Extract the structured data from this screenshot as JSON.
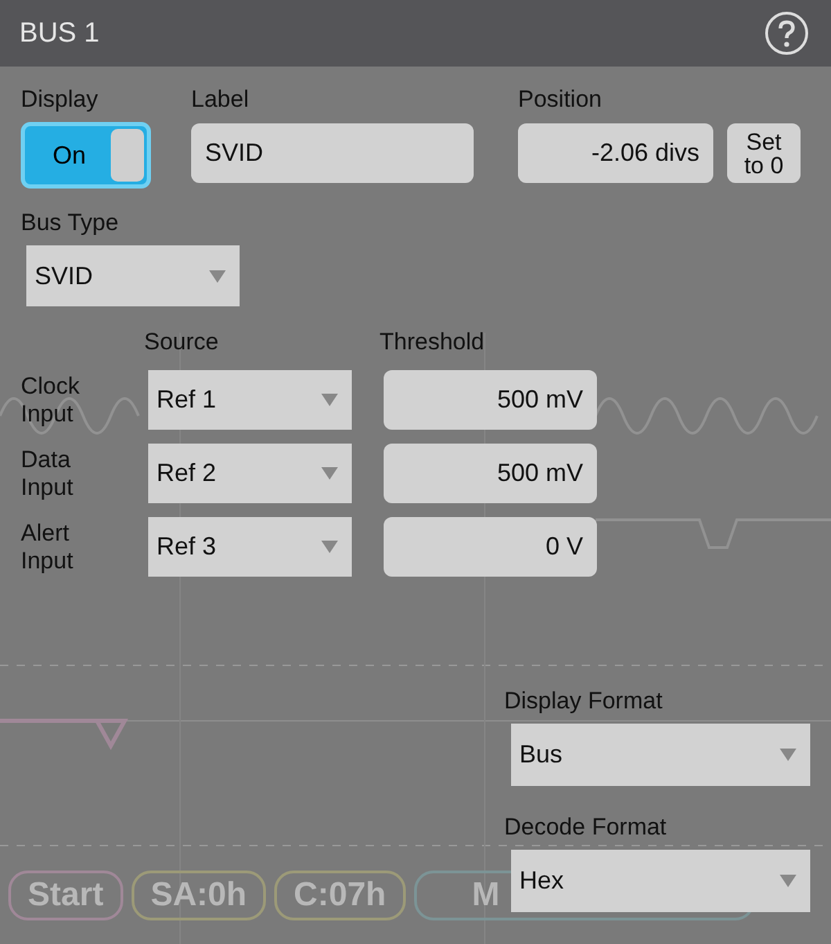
{
  "window": {
    "title": "BUS 1"
  },
  "display": {
    "label": "Display",
    "value": "On",
    "on": true
  },
  "label_field": {
    "label": "Label",
    "value": "SVID"
  },
  "position": {
    "label": "Position",
    "value": "-2.06 divs",
    "button": "Set to 0"
  },
  "bus_type": {
    "label": "Bus Type",
    "value": "SVID"
  },
  "inputs": {
    "source_header": "Source",
    "threshold_header": "Threshold",
    "rows": [
      {
        "name": "Clock Input",
        "source": "Ref 1",
        "threshold": "500 mV"
      },
      {
        "name": "Data Input",
        "source": "Ref 2",
        "threshold": "500 mV"
      },
      {
        "name": "Alert Input",
        "source": "Ref 3",
        "threshold": "0 V"
      }
    ]
  },
  "display_format": {
    "label": "Display Format",
    "value": "Bus"
  },
  "decode_format": {
    "label": "Decode Format",
    "value": "Hex"
  },
  "decode_bus": {
    "packets": [
      {
        "text": "Start",
        "color": "#a08898"
      },
      {
        "text": "SA:0h",
        "color": "#9c9a78"
      },
      {
        "text": "C:07h",
        "color": "#9c9a78"
      },
      {
        "text": "M",
        "color": "#7c9496"
      }
    ]
  }
}
